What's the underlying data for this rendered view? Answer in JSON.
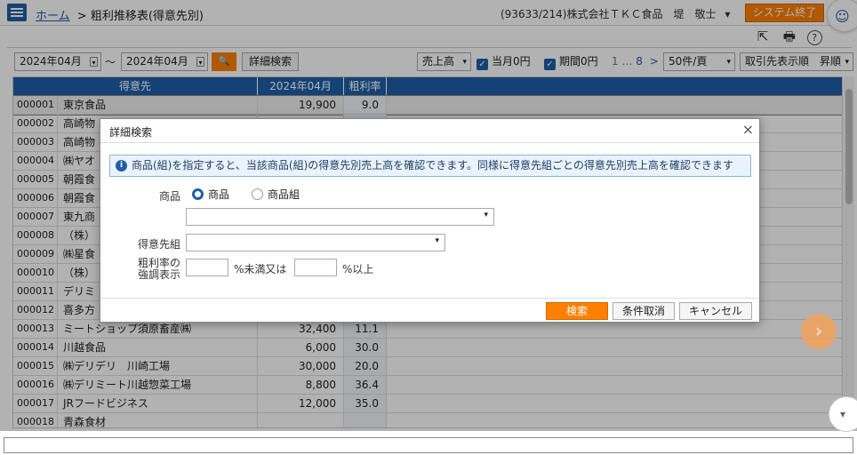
{
  "header": {
    "home_link": "ホーム",
    "breadcrumb_sep": ">",
    "page_title": "粗利推移表(得意先別)",
    "user_info": "(93633/214)株式会社ＴＫＣ食品　堤　敬士",
    "user_caret": "▾",
    "exit_button": "システム終了"
  },
  "filter": {
    "from_period": "2024年04月",
    "tilde": "～",
    "to_period": "2024年04月",
    "search_icon": "🔍",
    "detail_button": "詳細検索",
    "measure": "売上高",
    "check_current_zero": "当月0円",
    "check_period_zero": "期間0円",
    "pager_current": "1",
    "pager_dots": "…",
    "pager_last": "8",
    "pager_next": ">",
    "per_page": "50件/頁",
    "sort": "取引先表示順　昇順"
  },
  "grid": {
    "columns": [
      "得意先",
      "2024年04月",
      "粗利率"
    ],
    "rows": [
      {
        "code": "000001",
        "name": "東京食品",
        "amount": "19,900",
        "rate": "9.0"
      },
      {
        "code": "000002",
        "name": "高崎物",
        "amount": "",
        "rate": ""
      },
      {
        "code": "000003",
        "name": "高崎物",
        "amount": "",
        "rate": ""
      },
      {
        "code": "000004",
        "name": "㈱ヤオ",
        "amount": "",
        "rate": ""
      },
      {
        "code": "000005",
        "name": "朝霞食",
        "amount": "",
        "rate": ""
      },
      {
        "code": "000006",
        "name": "朝霞食",
        "amount": "",
        "rate": ""
      },
      {
        "code": "000007",
        "name": "東九商",
        "amount": "",
        "rate": ""
      },
      {
        "code": "000008",
        "name": "（株）",
        "amount": "",
        "rate": ""
      },
      {
        "code": "000009",
        "name": "㈱星食",
        "amount": "",
        "rate": ""
      },
      {
        "code": "000010",
        "name": "（株）",
        "amount": "",
        "rate": ""
      },
      {
        "code": "000011",
        "name": "デリミ",
        "amount": "",
        "rate": ""
      },
      {
        "code": "000012",
        "name": "喜多方",
        "amount": "",
        "rate": ""
      },
      {
        "code": "000013",
        "name": "ミートショップ須原畜産㈱",
        "amount": "32,400",
        "rate": "11.1"
      },
      {
        "code": "000014",
        "name": "川越食品",
        "amount": "6,000",
        "rate": "30.0"
      },
      {
        "code": "000015",
        "name": "㈱デリデリ　川崎工場",
        "amount": "30,000",
        "rate": "20.0"
      },
      {
        "code": "000016",
        "name": "㈱デリミート川越惣菜工場",
        "amount": "8,800",
        "rate": "36.4"
      },
      {
        "code": "000017",
        "name": "JRフードビジネス",
        "amount": "12,000",
        "rate": "35.0"
      },
      {
        "code": "000018",
        "name": "青森食材",
        "amount": "",
        "rate": ""
      }
    ]
  },
  "modal": {
    "title": "詳細検索",
    "close": "×",
    "info_icon": "i",
    "info_text": "商品(組)を指定すると、当該商品(組)の得意先別売上高を確認できます。同様に得意先組ごとの得意先別売上高を確認できます",
    "product_label": "商品",
    "radio_product": "商品",
    "radio_group": "商品組",
    "customer_group_label": "得意先組",
    "margin_label_1": "粗利率の",
    "margin_label_2": "強調表示",
    "less_than": "%未満又は",
    "more_than": "%以上",
    "search_button": "検索",
    "clear_button": "条件取消",
    "cancel_button": "キャンセル"
  },
  "icons": {
    "export": "⇱",
    "print": "🖶",
    "help": "?",
    "mascot": "☺",
    "next_arrow": "›",
    "down_arrow": "▾",
    "dropdown": "▾",
    "check": "✓"
  },
  "colors": {
    "primary": "#1f5fa8",
    "accent": "#ff7f00"
  }
}
